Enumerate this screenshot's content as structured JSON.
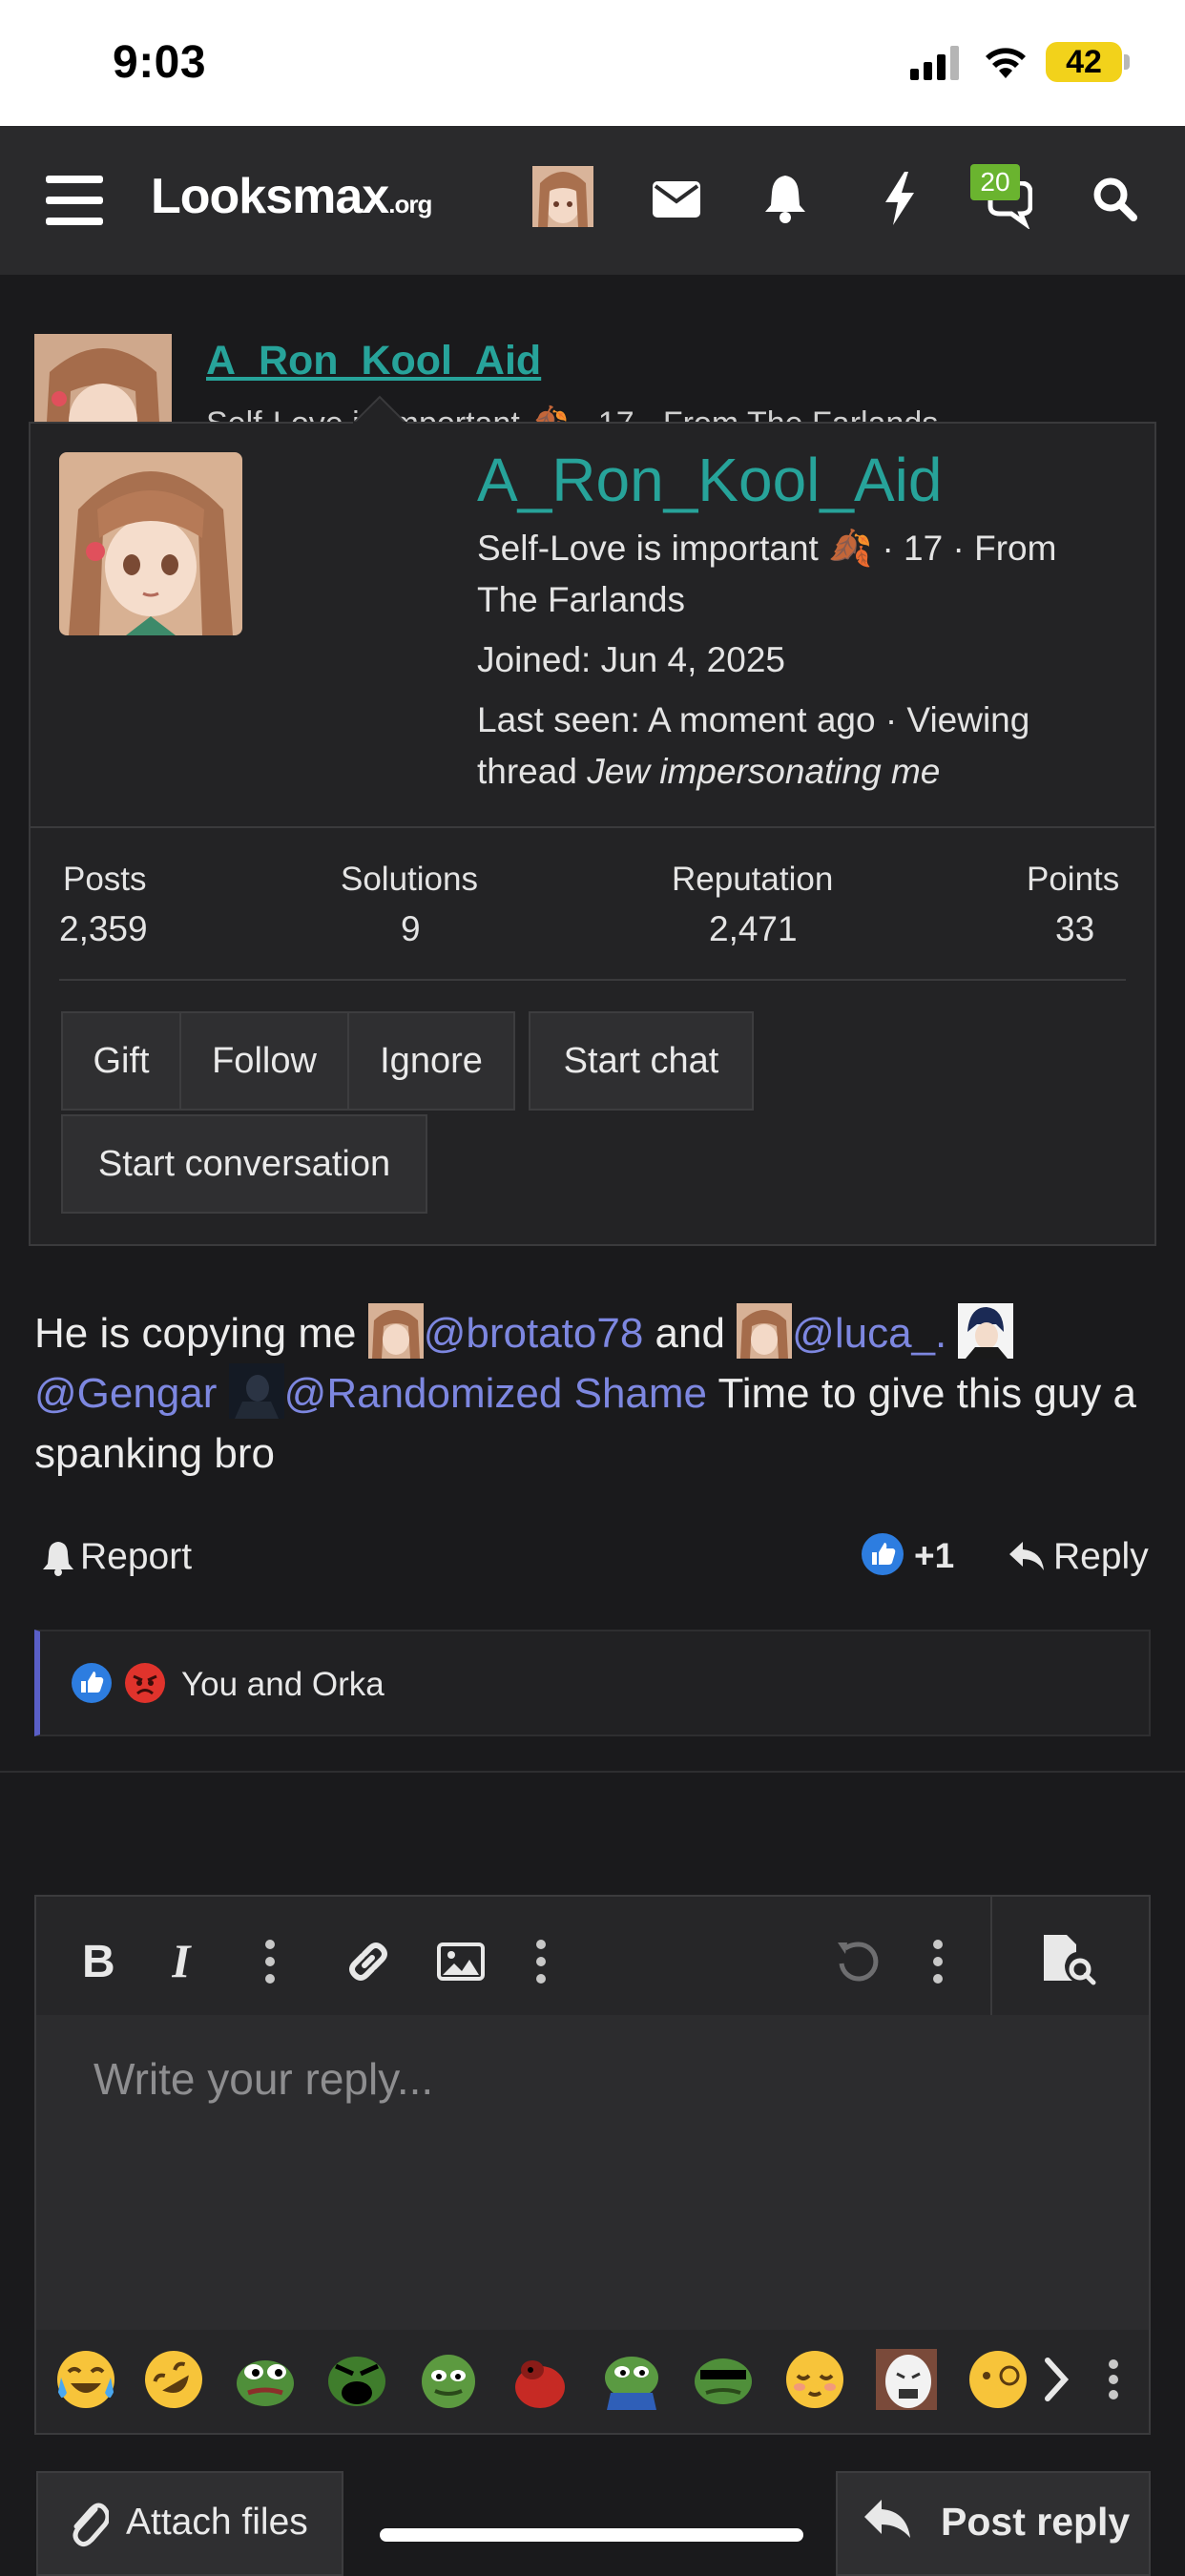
{
  "status_bar": {
    "time": "9:03",
    "battery": "42"
  },
  "navbar": {
    "logo": "Looksmax",
    "logo_suffix": ".org",
    "alerts_badge": "20"
  },
  "post": {
    "author": "A_Ron_Kool_Aid",
    "author_subtitle_partial": "Self-Love is important 🍂 · 17 · From The Farlands",
    "body": {
      "t1": "He is copying me ",
      "m1": "@brotato78",
      "t2": " and ",
      "m2": "@luca_.",
      "m3": "@Gengar",
      "m4": "@Randomized Shame",
      "t3": " Time to give this guy a spanking bro"
    },
    "actions": {
      "report": "Report",
      "plus_one": "+1",
      "reply": "Reply"
    },
    "reactions_text": "You and Orka"
  },
  "member_card": {
    "name": "A_Ron_Kool_Aid",
    "line1": "Self-Love is important 🍂 · 17 · From",
    "line2": "The Farlands",
    "joined": "Joined: Jun 4, 2025",
    "last_seen_1": "Last seen: A moment ago · Viewing",
    "last_seen_2_prefix": "thread ",
    "last_seen_2_thread": "Jew impersonating me",
    "stats": {
      "posts_label": "Posts",
      "posts": "2,359",
      "solutions_label": "Solutions",
      "solutions": "9",
      "reputation_label": "Reputation",
      "reputation": "2,471",
      "points_label": "Points",
      "points": "33"
    },
    "buttons": {
      "gift": "Gift",
      "follow": "Follow",
      "ignore": "Ignore",
      "start_chat": "Start chat",
      "start_conversation": "Start conversation"
    }
  },
  "editor": {
    "placeholder": "Write your reply...",
    "attach_files": "Attach files",
    "post_reply": "Post reply"
  },
  "colors": {
    "accent_teal": "#27a39a",
    "mention": "#7d87e0",
    "background": "#1a1a1c",
    "alert_badge": "#6ab42f"
  }
}
